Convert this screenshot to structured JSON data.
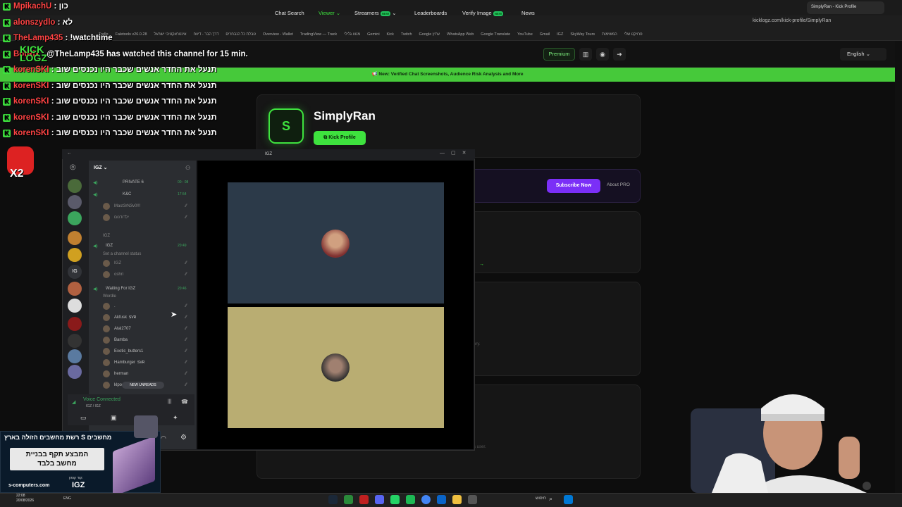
{
  "browser": {
    "tab_title": "SimplyRan - Kick Profile",
    "url": "kicklogz.com/kick-profile/SimplyRan",
    "bookmarks": [
      "Trello",
      "Faletools v26.0.28",
      "טבלת כל הנבחרים",
      "דרך הבר - דיווח",
      "אינטראקטיבי ישראל",
      "Overview - Wallet",
      "TradingView — Track",
      "מנוע גלילי",
      "Gemini",
      "Kick",
      "Twitch",
      "Google ערוץ",
      "WhatsApp Web",
      "Google Translate",
      "YouTube",
      "Gmail",
      "IGZ",
      "SkyWay Tours",
      "פרויקט שלי",
      "המשימות"
    ]
  },
  "nav": {
    "logo_line1": "KICK",
    "logo_line2": "LOGZ",
    "chat_search": "Chat Search",
    "viewer": "Viewer",
    "streamers": "Streamers",
    "new_badge": "NEW",
    "leaderboards": "Leaderboards",
    "verify_image": "Verify Image",
    "news": "News",
    "premium": "Premium",
    "language": "English"
  },
  "banner": "New: Verified Chat Screenshots, Audience Risk Analysis and More",
  "profile": {
    "avatar_letter": "S",
    "name": "SimplyRan",
    "kick_button": "Kick Profile",
    "subscribe_button": "Subscribe Now",
    "about_pro": "About PRO",
    "faint_text1": "ory.",
    "faint_text2": "s user."
  },
  "chat": [
    {
      "user": "MpikachU",
      "msg": "כון"
    },
    {
      "user": "alonszydlo",
      "msg": "לא"
    },
    {
      "user": "TheLamp435",
      "msg": "!watchtime"
    },
    {
      "user": "BotRix",
      "msg": "@TheLamp435 has watched this channel for 15 min."
    },
    {
      "user": "korenSKI",
      "msg": "תנעל את החדר אנשים שכבר היו נכנסים שוב"
    },
    {
      "user": "korenSKI",
      "msg": "תנעל את החדר אנשים שכבר היו נכנסים שוב"
    },
    {
      "user": "korenSKI",
      "msg": "תנעל את החדר אנשים שכבר היו נכנסים שוב"
    },
    {
      "user": "korenSKI",
      "msg": "תנעל את החדר אנשים שכבר היו נכנסים שוב"
    },
    {
      "user": "korenSKI",
      "msg": "תנעל את החדר אנשים שכבר היו נכנסים שוב"
    }
  ],
  "emote_label": "X2",
  "discord": {
    "window_title": "IGZ",
    "server_name": "IGZ",
    "guild_igz": "IG",
    "channels": [
      {
        "name": "PRIVATE 6",
        "time": "00 : 08"
      },
      {
        "name": "K&C",
        "time": "17:54"
      },
      {
        "name": "Mast3rN3v0!!!"
      },
      {
        "name": "ילדודנום"
      },
      {
        "name": "IGZ"
      },
      {
        "name": "IGZ",
        "time": "20:49"
      },
      {
        "name": "Set a channel status"
      },
      {
        "name": "IGZ"
      },
      {
        "name": "oshri"
      },
      {
        "name": "Waiting For IGZ",
        "time": "20:46"
      },
      {
        "name": "Wordle"
      },
      {
        "name": "."
      },
      {
        "name": "Akfusk",
        "tag": "SVR"
      },
      {
        "name": "Atal2707"
      },
      {
        "name": "Bamba"
      },
      {
        "name": "Exotic_butters1"
      },
      {
        "name": "Hamburger",
        "tag": "SVR"
      },
      {
        "name": "herman"
      },
      {
        "name": "klpos"
      }
    ],
    "new_unreads": "NEW UNREADS",
    "voice_connected": "Voice Connected",
    "voice_sub": "IGZ / IGZ"
  },
  "ad": {
    "headline": "רשת מחשבים הזולה בארץ S מחשבים",
    "box_line1": "המבצע תקף בבניית",
    "box_line2": "מחשב בלבד",
    "site": "s-computers.com",
    "code_label": "קוד קופון:",
    "code": "IGZ"
  },
  "taskbar": {
    "time": "22:08",
    "date": "20/08/2026",
    "lang": "ENG",
    "search": "חיפוש"
  },
  "colors": {
    "accent": "#3ee23e",
    "banner": "#46c93a",
    "subscribe": "#7b2ff7",
    "chat_user": "#ff4444"
  }
}
